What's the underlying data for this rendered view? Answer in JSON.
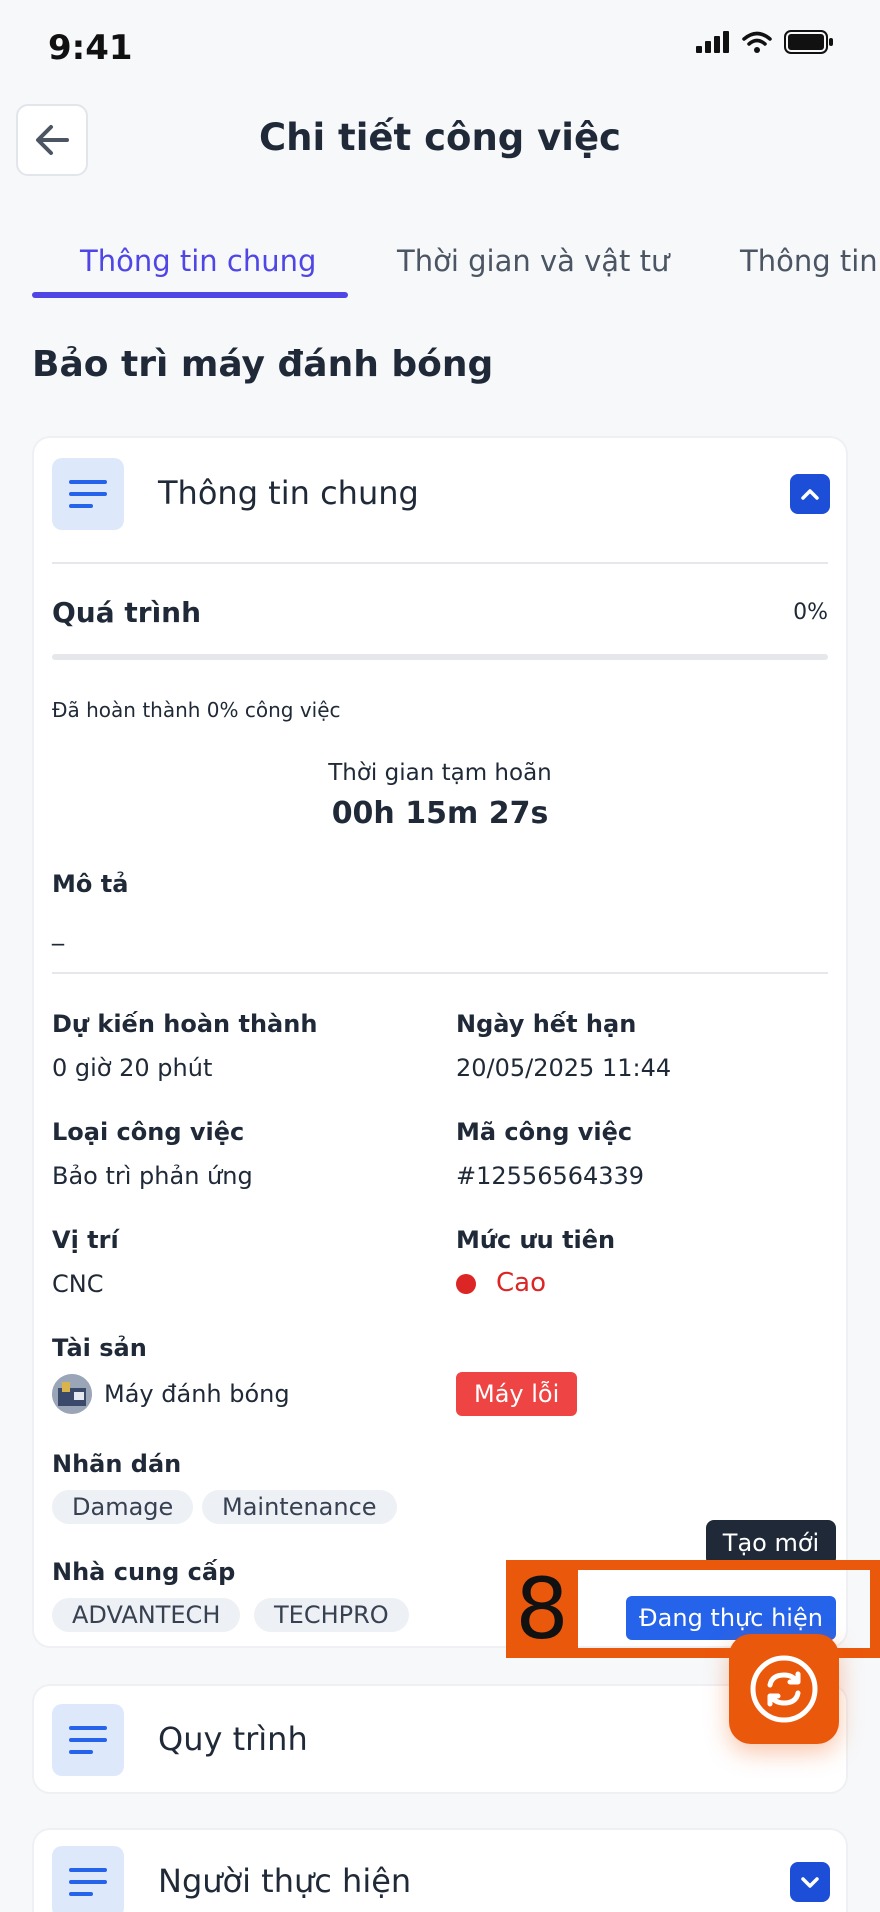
{
  "status_bar": {
    "time": "9:41"
  },
  "header": {
    "title": "Chi tiết công việc"
  },
  "tabs": [
    {
      "label": "Thông tin chung",
      "active": true
    },
    {
      "label": "Thời gian và vật tư",
      "active": false
    },
    {
      "label": "Thông tin x",
      "active": false
    }
  ],
  "job": {
    "title": "Bảo trì máy đánh bóng"
  },
  "general_card": {
    "title": "Thông tin chung",
    "progress_label": "Quá trình",
    "progress_percent_text": "0%",
    "progress_value": 0,
    "completed_text": "Đã hoàn thành 0% công việc",
    "pause_label": "Thời gian tạm hoãn",
    "pause_time": "00h 15m 27s",
    "description_label": "Mô tả",
    "description_value": "_",
    "fields": {
      "expected_label": "Dự kiến hoàn thành",
      "expected_value": "0 giờ 20 phút",
      "due_label": "Ngày hết hạn",
      "due_value": "20/05/2025 11:44",
      "type_label": "Loại công việc",
      "type_value": "Bảo trì phản ứng",
      "code_label": "Mã công việc",
      "code_value": "#12556564339",
      "location_label": "Vị trí",
      "location_value": "CNC",
      "priority_label": "Mức ưu tiên",
      "priority_value": "Cao",
      "asset_label": "Tài sản",
      "asset_value": "Máy đánh bóng",
      "asset_status": "Máy lỗi",
      "tags_label": "Nhãn dán",
      "tags": [
        "Damage",
        "Maintenance"
      ],
      "suppliers_label": "Nhà cung cấp",
      "suppliers": [
        "ADVANTECH",
        "TECHPRO"
      ]
    }
  },
  "process_card": {
    "title": "Quy trình"
  },
  "assignee_card": {
    "title": "Người thực hiện"
  },
  "actions": {
    "tooltip": "Tạo mới",
    "status_button": "Đang thực hiện",
    "overlay_number": "8"
  },
  "colors": {
    "accent": "#4f46e5",
    "primary_button": "#2563eb",
    "danger": "#ef4444",
    "fab": "#ea580c"
  }
}
